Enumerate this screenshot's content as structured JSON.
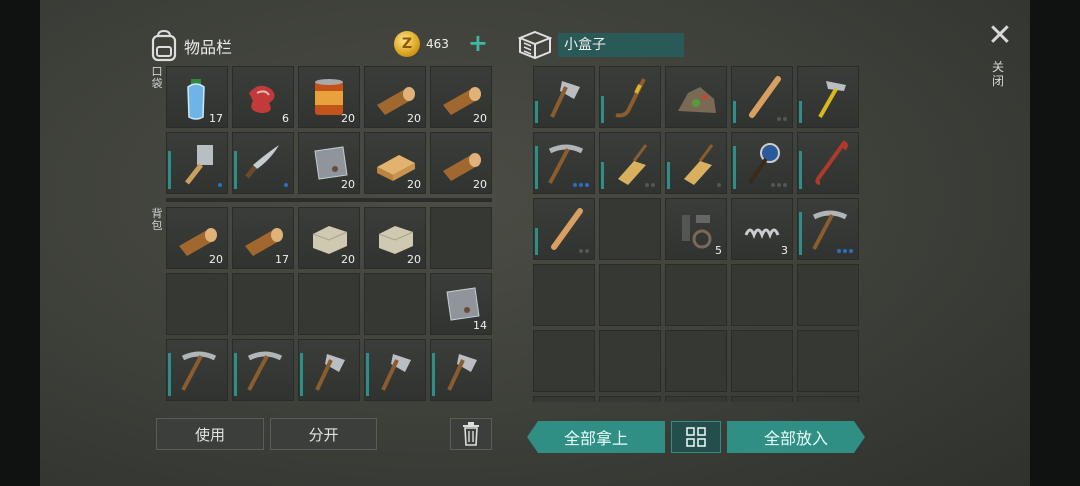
{
  "inventory": {
    "title": "物品栏",
    "coins": "463",
    "pocket_label": "口袋",
    "backpack_label": "背包",
    "pocket": [
      {
        "item": "water-bottle",
        "count": "17"
      },
      {
        "item": "raw-meat",
        "count": "6"
      },
      {
        "item": "canned-food",
        "count": "20"
      },
      {
        "item": "log",
        "count": "20"
      },
      {
        "item": "log",
        "count": "20"
      },
      {
        "item": "cleaver",
        "count": "",
        "bar": 0.7,
        "dots": [
          "b"
        ]
      },
      {
        "item": "machete",
        "count": "",
        "bar": 0.7,
        "dots": [
          "b"
        ]
      },
      {
        "item": "metal-scrap",
        "count": "20"
      },
      {
        "item": "plank",
        "count": "20"
      },
      {
        "item": "log",
        "count": "20"
      }
    ],
    "backpack": [
      {
        "item": "log",
        "count": "20"
      },
      {
        "item": "log",
        "count": "17"
      },
      {
        "item": "stone",
        "count": "20"
      },
      {
        "item": "stone",
        "count": "20"
      },
      {
        "item": "empty",
        "count": ""
      },
      {
        "item": "empty",
        "count": ""
      },
      {
        "item": "empty",
        "count": ""
      },
      {
        "item": "empty",
        "count": ""
      },
      {
        "item": "empty",
        "count": ""
      },
      {
        "item": "metal-scrap",
        "count": "14"
      },
      {
        "item": "pickaxe",
        "count": "",
        "bar": 0.8
      },
      {
        "item": "pickaxe",
        "count": "",
        "bar": 0.8
      },
      {
        "item": "hatchet",
        "count": "",
        "bar": 0.8
      },
      {
        "item": "hatchet",
        "count": "",
        "bar": 0.8
      },
      {
        "item": "hatchet",
        "count": "",
        "bar": 0.8
      }
    ]
  },
  "box": {
    "name": "小盒子",
    "slots": [
      {
        "item": "hatchet",
        "count": "",
        "bar": 0.4
      },
      {
        "item": "hockey-stick",
        "count": "",
        "bar": 0.5
      },
      {
        "item": "junk-pile",
        "count": ""
      },
      {
        "item": "baseball-bat",
        "count": "",
        "bar": 0.4,
        "dots": [
          "g",
          "g"
        ]
      },
      {
        "item": "hammer",
        "count": "",
        "bar": 0.4
      },
      {
        "item": "pickaxe",
        "count": "",
        "bar": 0.8,
        "dots": [
          "b",
          "b",
          "b"
        ]
      },
      {
        "item": "broom",
        "count": "",
        "bar": 0.5,
        "dots": [
          "g",
          "g"
        ]
      },
      {
        "item": "broom",
        "count": "",
        "bar": 0.5,
        "dots": [
          "g"
        ]
      },
      {
        "item": "spiked-mace",
        "count": "",
        "bar": 0.8,
        "dots": [
          "g",
          "g",
          "g"
        ]
      },
      {
        "item": "crowbar",
        "count": "",
        "bar": 0.7
      },
      {
        "item": "baseball-bat",
        "count": "",
        "bar": 0.5,
        "dots": [
          "g",
          "g"
        ]
      },
      {
        "item": "empty",
        "count": ""
      },
      {
        "item": "parts",
        "count": "5"
      },
      {
        "item": "spring",
        "count": "3"
      },
      {
        "item": "pickaxe",
        "count": "",
        "bar": 0.8,
        "dots": [
          "b",
          "b",
          "b"
        ]
      },
      {
        "item": "empty",
        "count": ""
      },
      {
        "item": "empty",
        "count": ""
      },
      {
        "item": "empty",
        "count": ""
      },
      {
        "item": "empty",
        "count": ""
      },
      {
        "item": "empty",
        "count": ""
      },
      {
        "item": "empty",
        "count": ""
      },
      {
        "item": "empty",
        "count": ""
      },
      {
        "item": "empty",
        "count": ""
      },
      {
        "item": "empty",
        "count": ""
      },
      {
        "item": "empty",
        "count": ""
      },
      {
        "item": "empty",
        "count": ""
      },
      {
        "item": "empty",
        "count": ""
      },
      {
        "item": "empty",
        "count": ""
      },
      {
        "item": "empty",
        "count": ""
      },
      {
        "item": "empty",
        "count": ""
      }
    ]
  },
  "buttons": {
    "use": "使用",
    "split": "分开",
    "take_all": "全部拿上",
    "put_all": "全部放入",
    "close": "关闭"
  },
  "icons": {
    "backpack": "backpack-icon",
    "coin": "coin-icon",
    "add": "plus-icon",
    "box": "box-icon",
    "close": "close-icon",
    "trash": "trash-icon",
    "sort": "grid-sort-icon"
  },
  "colors": {
    "accent": "#2f8f85",
    "durability": "#2d8f87",
    "blue_dot": "#2c6fbf",
    "coin": "#d9a31e"
  }
}
